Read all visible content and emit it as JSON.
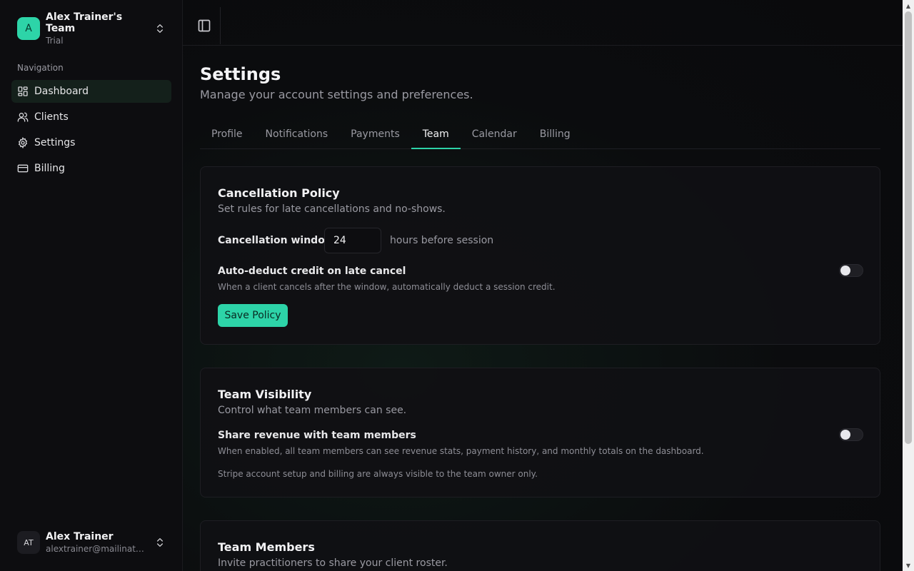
{
  "team": {
    "avatar_letter": "A",
    "name": "Alex Trainer's Team",
    "plan": "Trial"
  },
  "nav": {
    "heading": "Navigation",
    "items": [
      {
        "label": "Dashboard",
        "icon": "dashboard-icon",
        "active": true
      },
      {
        "label": "Clients",
        "icon": "users-icon",
        "active": false
      },
      {
        "label": "Settings",
        "icon": "gear-icon",
        "active": false
      },
      {
        "label": "Billing",
        "icon": "credit-card-icon",
        "active": false
      }
    ]
  },
  "user": {
    "initials": "AT",
    "name": "Alex Trainer",
    "email": "alextrainer@mailinator.c..."
  },
  "page": {
    "title": "Settings",
    "subtitle": "Manage your account settings and preferences."
  },
  "tabs": [
    {
      "label": "Profile",
      "active": false
    },
    {
      "label": "Notifications",
      "active": false
    },
    {
      "label": "Payments",
      "active": false
    },
    {
      "label": "Team",
      "active": true
    },
    {
      "label": "Calendar",
      "active": false
    },
    {
      "label": "Billing",
      "active": false
    }
  ],
  "cancellation": {
    "title": "Cancellation Policy",
    "description": "Set rules for late cancellations and no-shows.",
    "window_label": "Cancellation window",
    "window_value": "24",
    "window_suffix": "hours before session",
    "auto_deduct_label": "Auto-deduct credit on late cancel",
    "auto_deduct_desc": "When a client cancels after the window, automatically deduct a session credit.",
    "auto_deduct_enabled": false,
    "save_label": "Save Policy"
  },
  "visibility": {
    "title": "Team Visibility",
    "description": "Control what team members can see.",
    "share_label": "Share revenue with team members",
    "share_desc": "When enabled, all team members can see revenue stats, payment history, and monthly totals on the dashboard.",
    "share_enabled": false,
    "note": "Stripe account setup and billing are always visible to the team owner only."
  },
  "members": {
    "title": "Team Members",
    "description": "Invite practitioners to share your client roster."
  },
  "colors": {
    "accent": "#2dd4a8",
    "background": "#0b0b0d"
  }
}
